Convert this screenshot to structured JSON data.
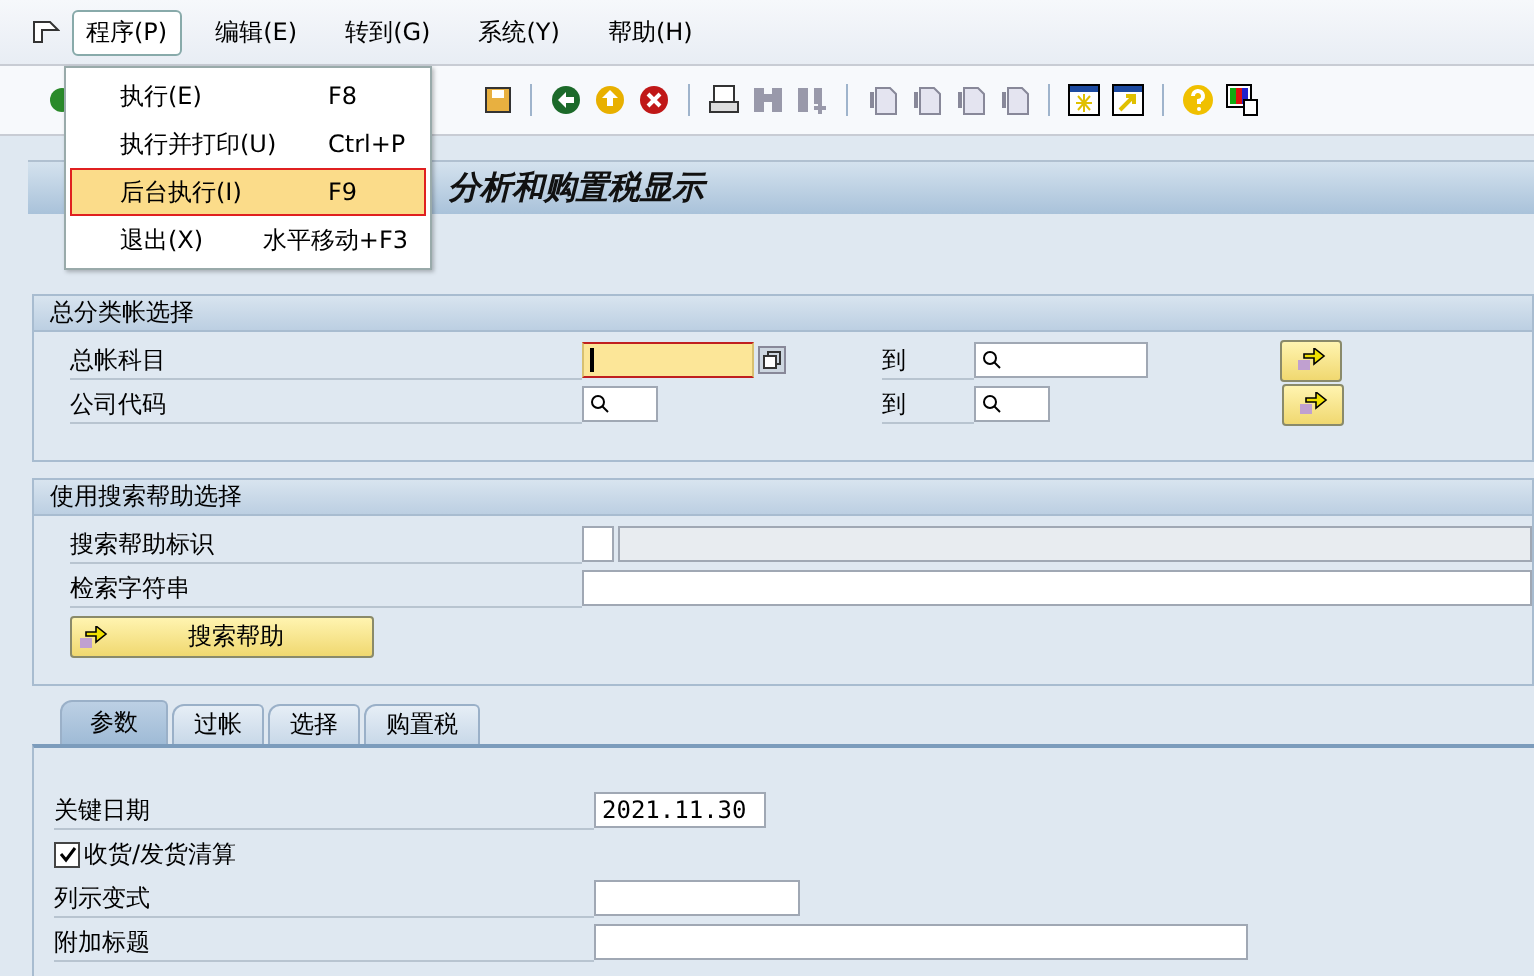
{
  "menu_bar": [
    {
      "label": "程序(P)",
      "selected": true
    },
    {
      "label": "编辑(E)",
      "selected": false
    },
    {
      "label": "转到(G)",
      "selected": false
    },
    {
      "label": "系统(Y)",
      "selected": false
    },
    {
      "label": "帮助(H)",
      "selected": false
    }
  ],
  "dropdown": [
    {
      "label": "执行(E)",
      "shortcut": "F8",
      "selected": false
    },
    {
      "label": "执行并打印(U)",
      "shortcut": "Ctrl+P",
      "selected": false
    },
    {
      "label": "后台执行(I)",
      "shortcut": "F9",
      "selected": true
    },
    {
      "label": "退出(X)",
      "shortcut": "水平移动+F3",
      "selected": false
    }
  ],
  "title": "分析和购置税显示",
  "group_ledger": {
    "title": "总分类帐选择",
    "rows": [
      {
        "label": "总帐科目",
        "focused": true,
        "to_label": "到"
      },
      {
        "label": "公司代码",
        "focused": false,
        "to_label": "到"
      }
    ]
  },
  "group_search": {
    "title": "使用搜索帮助选择",
    "id_label": "搜索帮助标识",
    "string_label": "检索字符串",
    "button": "搜索帮助"
  },
  "tabs": [
    {
      "label": "参数",
      "selected": true
    },
    {
      "label": "过帐",
      "selected": false
    },
    {
      "label": "选择",
      "selected": false
    },
    {
      "label": "购置税",
      "selected": false
    }
  ],
  "parameters": {
    "key_date_label": "关键日期",
    "key_date": "2021.11.30",
    "clearing": {
      "label": "收货/发货清算",
      "checked": true
    },
    "layout_label": "列示变式",
    "header_label": "附加标题"
  }
}
